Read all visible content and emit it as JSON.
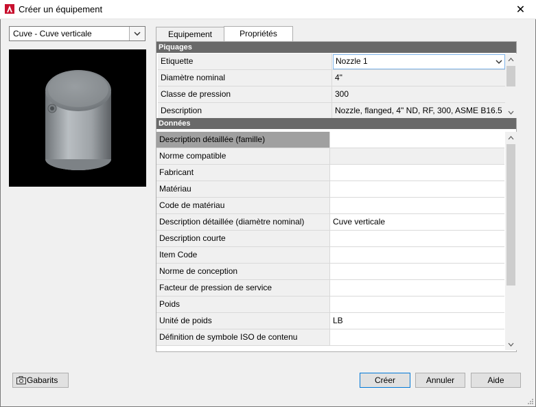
{
  "window": {
    "title": "Créer un équipement",
    "close_glyph": "✕"
  },
  "equipment_select": {
    "value": "Cuve - Cuve verticale"
  },
  "tabs": [
    {
      "label": "Equipement"
    },
    {
      "label": "Propriétés"
    }
  ],
  "piquages": {
    "header": "Piquages",
    "rows": [
      {
        "label": "Etiquette",
        "value": "Nozzle 1"
      },
      {
        "label": "Diamètre nominal",
        "value": "4\""
      },
      {
        "label": "Classe de pression",
        "value": "300"
      },
      {
        "label": "Description",
        "value": "Nozzle, flanged, 4\" ND, RF, 300, ASME B16.5"
      }
    ]
  },
  "donnees": {
    "header": "Données",
    "rows": [
      {
        "label": "Description détaillée (famille)",
        "value": ""
      },
      {
        "label": "Norme compatible",
        "value": ""
      },
      {
        "label": "Fabricant",
        "value": ""
      },
      {
        "label": "Matériau",
        "value": ""
      },
      {
        "label": "Code de matériau",
        "value": ""
      },
      {
        "label": "Description détaillée (diamètre nominal)",
        "value": "Cuve verticale"
      },
      {
        "label": "Description courte",
        "value": ""
      },
      {
        "label": "Item Code",
        "value": ""
      },
      {
        "label": "Norme de conception",
        "value": ""
      },
      {
        "label": "Facteur de pression de service",
        "value": ""
      },
      {
        "label": "Poids",
        "value": ""
      },
      {
        "label": "Unité de poids",
        "value": "LB"
      },
      {
        "label": "Définition de symbole ISO de contenu",
        "value": ""
      }
    ]
  },
  "buttons": {
    "gabarits": "Gabarits",
    "creer": "Créer",
    "annuler": "Annuler",
    "aide": "Aide"
  },
  "colors": {
    "accent": "#0078d7",
    "section_header": "#696969",
    "app_icon": "#c8102e"
  }
}
